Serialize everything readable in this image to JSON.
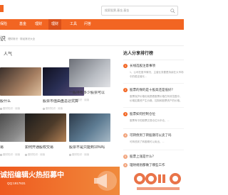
{
  "header": {
    "search_placeholder": "搜索股票,基金,基金",
    "search_icon": "search-icon"
  },
  "nav": {
    "items": [
      "保险",
      "基金",
      "理财",
      "工具",
      "问答"
    ],
    "active_index": 3,
    "accent_color": "#f26522"
  },
  "breadcrumb": {
    "title": "识",
    "subtitle": "理财常识 · 财经常识大全"
  },
  "hot": {
    "title": "人气",
    "cards": [
      {
        "title": "股什么",
        "meta": "股财知识 · 阅读"
      },
      {
        "title": "股票市值由盘总达式算",
        "meta": "股财知识 · 阅读"
      },
      {
        "title": "一般持有多少股票可以",
        "meta": "股财知识 · 阅读"
      },
      {
        "title": "易",
        "meta": "股财知识 · 阅读"
      },
      {
        "title": "如何开通股权交易",
        "meta": "股财知识 · 阅读"
      },
      {
        "title": "股票不是只能到10%吗",
        "meta": "股财知识 · 阅读"
      }
    ]
  },
  "ranking": {
    "title": "达人分享排行榜",
    "items": [
      {
        "num": "1",
        "title": "长线选股注意事项",
        "desc": "1、公司在股市情况、主营业务要是持续在大市场中的稳定增长..."
      },
      {
        "num": "2",
        "title": "股票的保的是十股高还是低好？",
        "desc": "股票保护价格也就是看股票价格在有效范围中，价格如果资产生价格，控制和股票资产的价格。"
      },
      {
        "num": "3",
        "title": "股票如何控制仓位",
        "desc": "股票有中的股票交易仓位为半仓，..."
      },
      {
        "num": "4",
        "title": "可转债到了转股期可以卖了吗",
        "desc": "可转债到了转股期可以卖出，..."
      },
      {
        "num": "5",
        "title": "股票上涨是什么？",
        "desc": ""
      },
      {
        "num": "6",
        "title": "理财规划都做了哪些工作",
        "desc": ""
      }
    ]
  },
  "banner": {
    "title": "诚招编辑火热招募中",
    "qq": "QQ:1917631"
  }
}
